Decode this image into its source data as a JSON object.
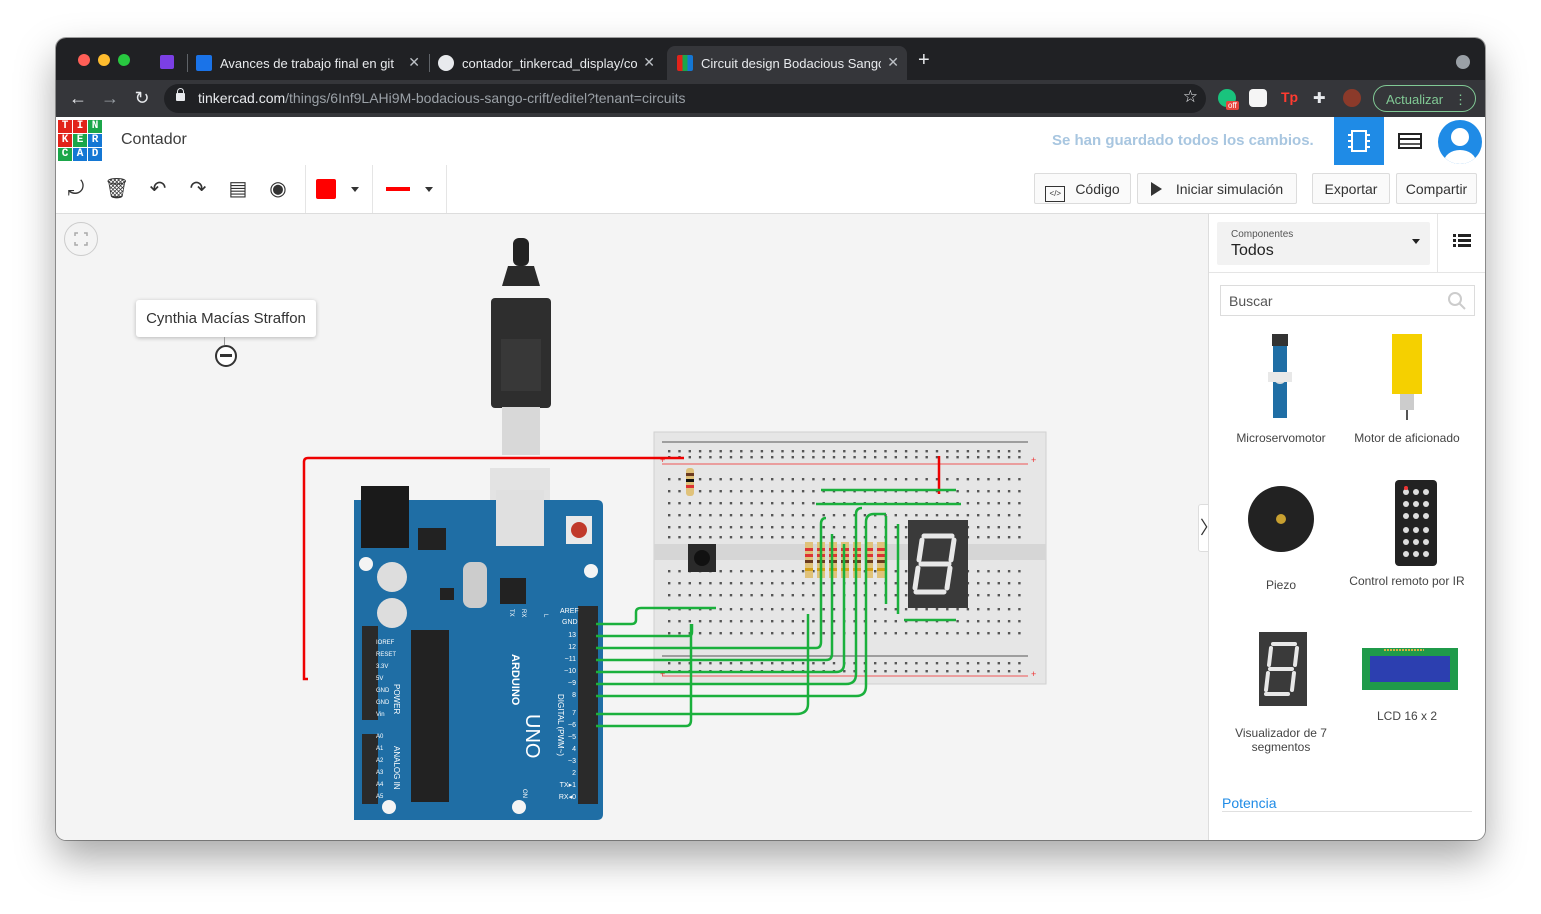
{
  "browser": {
    "tabs": [
      {
        "title": "Avances de trabajo final en git",
        "favicon": "google-classroom-icon"
      },
      {
        "title": "contador_tinkercad_display/co",
        "favicon": "github-icon"
      },
      {
        "title": "Circuit design Bodacious Sango",
        "favicon": "tinkercad-icon"
      }
    ],
    "new_tab": "+",
    "url_domain": "tinkercad.com",
    "url_path": "/things/6Inf9LAHi9M-bodacious-sango-crift/editel?tenant=circuits",
    "update_button": "Actualizar",
    "extension_badge": "off"
  },
  "header": {
    "logo_letters": [
      "T",
      "I",
      "N",
      "K",
      "E",
      "R",
      "C",
      "A",
      "D"
    ],
    "logo_colors": [
      "#e2231a",
      "#e2231a",
      "#1ba64a",
      "#e2231a",
      "#1ba64a",
      "#1477d4",
      "#1ba64a",
      "#1477d4",
      "#1477d4"
    ],
    "project_name": "Contador",
    "save_status": "Se han guardado todos los cambios."
  },
  "toolbar": {
    "code_button": "Código",
    "simulate_button": "Iniciar simulación",
    "export_button": "Exportar",
    "share_button": "Compartir",
    "wire_color": "#ff0000"
  },
  "canvas": {
    "note_text": "Cynthia Macías Straffon",
    "arduino_labels": {
      "brand": "ARDUINO",
      "model": "UNO",
      "power": "POWER",
      "analog": "ANALOG IN",
      "digital": "DIGITAL (PWM~)",
      "aref": "AREF",
      "gnd": "GND",
      "pins_digital": [
        "13",
        "12",
        "~11",
        "~10",
        "~9",
        "8",
        "7",
        "~6",
        "~5",
        "4",
        "~3",
        "2",
        "TX▸1",
        "RX◂0"
      ],
      "pins_power": [
        "IOREF",
        "RESET",
        "3.3V",
        "5V",
        "GND",
        "GND",
        "Vin"
      ],
      "pins_analog": [
        "A0",
        "A1",
        "A2",
        "A3",
        "A4",
        "A5"
      ],
      "tx": "TX",
      "rx": "RX",
      "l": "L",
      "on": "ON"
    }
  },
  "panel": {
    "components_label": "Componentes",
    "components_value": "Todos",
    "search_placeholder": "Buscar",
    "items": [
      {
        "label": "Microservomotor"
      },
      {
        "label": "Motor de aficionado"
      },
      {
        "label": "Piezo"
      },
      {
        "label": "Control remoto por IR"
      },
      {
        "label": "Visualizador de 7 segmentos"
      },
      {
        "label": "LCD 16 x 2"
      }
    ],
    "section_title": "Potencia"
  }
}
